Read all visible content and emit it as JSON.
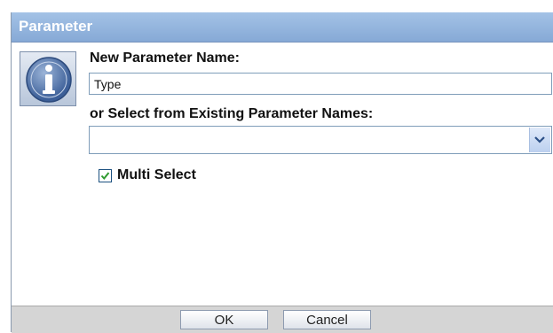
{
  "dialog": {
    "title": "Parameter",
    "new_name_label": "New Parameter Name:",
    "new_name_value": "Type",
    "existing_label": "or Select from Existing Parameter Names:",
    "existing_selected": "",
    "multi_select_label": "Multi Select",
    "multi_select_checked": true,
    "ok_label": "OK",
    "cancel_label": "Cancel"
  },
  "icons": {
    "info": "info-icon",
    "dropdown": "chevron-down-icon",
    "check": "checkmark-icon"
  },
  "colors": {
    "titlebar": "#93b5e0",
    "title_text": "#ffffff",
    "footer": "#d5d5d5",
    "check_mark": "#2f9a2f",
    "dropdown_arrow": "#2b4f86"
  }
}
